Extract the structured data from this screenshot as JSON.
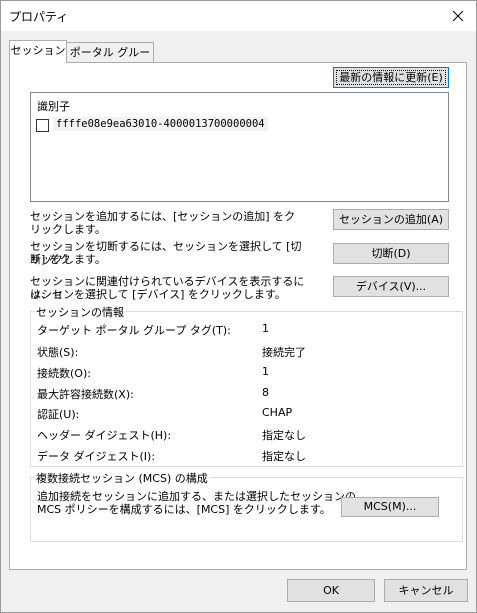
{
  "window": {
    "title": "プロパティ"
  },
  "tabs": [
    {
      "label": "セッション",
      "active": true
    },
    {
      "label": "ポータル グループ",
      "active": false
    }
  ],
  "refresh_button": "最新の情報に更新(E)",
  "targets_list": {
    "header": "識別子",
    "items": [
      {
        "label": "ffffe08e9ea63010-4000013700000004",
        "checked": false
      }
    ]
  },
  "add_session": {
    "description": "セッションを追加するには、[セッションの追加] をクリックします。",
    "button": "セッションの追加(A)"
  },
  "disconnect": {
    "description_line1": "セッションを切断するには、セッションを選択して [切断] をク",
    "description_line2": "リックします。",
    "button": "切断(D)"
  },
  "devices": {
    "description_line1": "セッションに関連付けられているデバイスを表示するには、セ",
    "description_line2": "ッションを選択して [デバイス] をクリックします。",
    "button": "デバイス(V)..."
  },
  "session_info": {
    "title": "セッションの情報",
    "rows": [
      {
        "label": "ターゲット ポータル グループ タグ(T):",
        "value": "1"
      },
      {
        "label": "状態(S):",
        "value": "接続完了"
      },
      {
        "label": "接続数(O):",
        "value": "1"
      },
      {
        "label": "最大許容接続数(X):",
        "value": "8"
      },
      {
        "label": "認証(U):",
        "value": "CHAP"
      },
      {
        "label": "ヘッダー ダイジェスト(H):",
        "value": "指定なし"
      },
      {
        "label": "データ ダイジェスト(I):",
        "value": "指定なし"
      }
    ]
  },
  "mcs": {
    "title": "複数接続セッション (MCS) の構成",
    "description_line1": "追加接続をセッションに追加する、または選択したセッションの",
    "description_line2": "MCS ポリシーを構成するには、[MCS] をクリックします。",
    "button": "MCS(M)..."
  },
  "footer": {
    "ok": "OK",
    "cancel": "キャンセル"
  }
}
